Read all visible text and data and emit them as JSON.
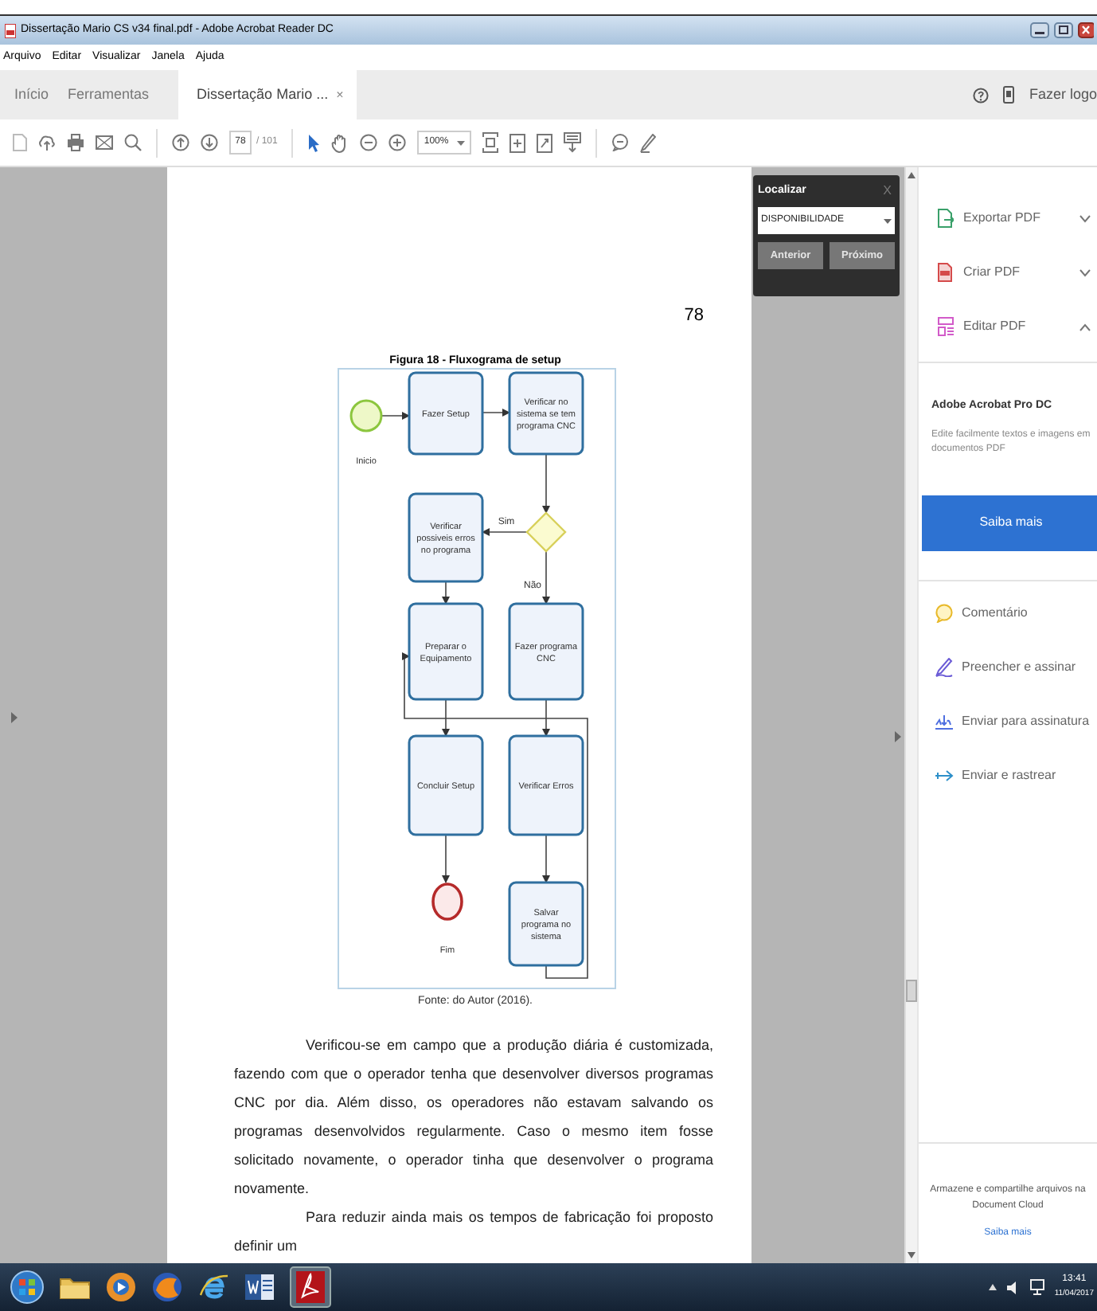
{
  "window": {
    "title": "Dissertação Mario CS v34 final.pdf - Adobe Acrobat Reader DC"
  },
  "menu": [
    "Arquivo",
    "Editar",
    "Visualizar",
    "Janela",
    "Ajuda"
  ],
  "tabs": [
    {
      "label": "Início",
      "selected": false
    },
    {
      "label": "Ferramentas",
      "selected": false
    },
    {
      "label": "Dissertação Mario ...",
      "selected": true,
      "close": "×"
    }
  ],
  "account": {
    "label": "Fazer logo"
  },
  "toolbar": {
    "page": "78",
    "page_total": "/ 101",
    "zoom": "100%"
  },
  "find": {
    "title": "Localizar",
    "close": "X",
    "query": "DISPONIBILIDADE",
    "buttons": [
      "Anterior",
      "Próximo"
    ]
  },
  "page": {
    "number": "78",
    "figure_caption": "Figura 18 - Fluxograma de setup",
    "flowchart": {
      "nodes": [
        {
          "kind": "start",
          "lines": [
            "Inicio"
          ]
        },
        {
          "kind": "task",
          "lines": [
            "Fazer Setup"
          ]
        },
        {
          "kind": "task",
          "lines": [
            "Verificar no",
            "sistema  se tem",
            "programa CNC"
          ]
        },
        {
          "kind": "decision"
        },
        {
          "kind": "task",
          "lines": [
            "Verificar",
            "possiveis erros",
            "no programa"
          ]
        },
        {
          "kind": "task",
          "lines": [
            "Preparar o",
            "Equipamento"
          ]
        },
        {
          "kind": "task",
          "lines": [
            "Fazer programa",
            "CNC"
          ]
        },
        {
          "kind": "task",
          "lines": [
            "Concluir Setup"
          ]
        },
        {
          "kind": "task",
          "lines": [
            "Verificar Erros"
          ]
        },
        {
          "kind": "end",
          "lines": [
            "Fim"
          ]
        },
        {
          "kind": "task",
          "lines": [
            "Salvar",
            "programa no",
            "sistema"
          ]
        }
      ],
      "edge_labels": [
        "Sim",
        "Não"
      ]
    },
    "source": "Fonte: do Autor (2016).",
    "paragraphs": [
      "Verificou-se em campo que a produção diária é customizada, fazendo com que o operador tenha que desenvolver diversos programas CNC por dia. Além disso, os operadores não estavam salvando os programas desenvolvidos regularmente. Caso o mesmo item fosse solicitado novamente, o operador tinha que desenvolver o programa novamente.",
      "Para reduzir ainda mais os tempos de fabricação foi proposto definir um"
    ]
  },
  "tools_panel": {
    "sections": [
      {
        "label": "Exportar PDF",
        "expanded": false
      },
      {
        "label": "Criar PDF",
        "expanded": false
      },
      {
        "label": "Editar PDF",
        "expanded": true
      }
    ],
    "promo": {
      "title": "Adobe Acrobat Pro DC",
      "text": "Edite facilmente textos e imagens em documentos PDF",
      "button": "Saiba mais"
    },
    "tools": [
      "Comentário",
      "Preencher e assinar",
      "Enviar para assinatura",
      "Enviar e rastrear"
    ],
    "cloud": {
      "text": "Armazene e compartilhe arquivos na Document Cloud",
      "link": "Saiba mais"
    }
  },
  "taskbar": {
    "time": "13:41",
    "date": "11/04/2017"
  }
}
